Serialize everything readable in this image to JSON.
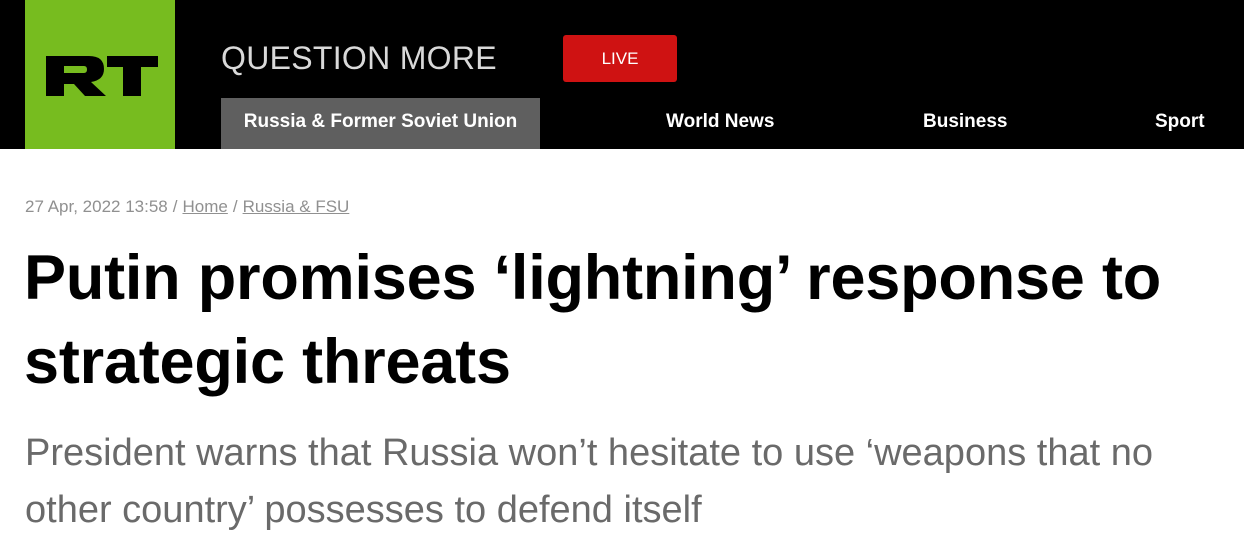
{
  "header": {
    "logo_text": "RT",
    "tagline": "QUESTION MORE",
    "live_label": "LIVE",
    "colors": {
      "brand_green": "#77bc1f",
      "live_red": "#cf1212",
      "active_tab_gray": "#5f5f5f"
    }
  },
  "nav": {
    "items": [
      {
        "label": "Russia & Former Soviet Union",
        "active": true
      },
      {
        "label": "World News",
        "active": false
      },
      {
        "label": "Business",
        "active": false
      },
      {
        "label": "Sport",
        "active": false
      }
    ]
  },
  "article": {
    "timestamp": "27 Apr, 2022 13:58",
    "separator": "/",
    "breadcrumb": [
      "Home",
      "Russia & FSU"
    ],
    "headline": "Putin promises ‘lightning’ response to strategic threats",
    "summary": "President warns that Russia won’t hesitate to use ‘weapons that no other country’ possesses to defend itself"
  }
}
